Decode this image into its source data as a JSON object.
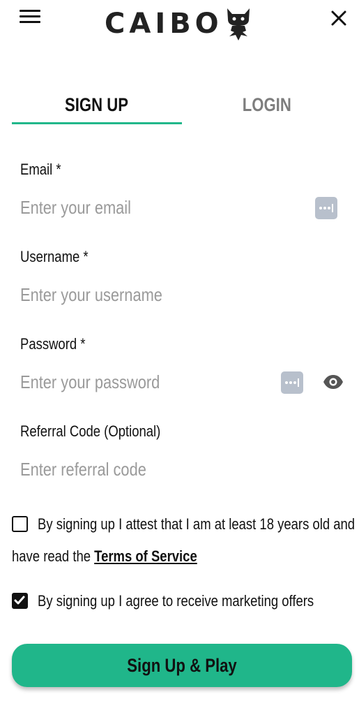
{
  "header": {
    "logo_text": "CAIBO",
    "menu_icon": "hamburger-menu-icon",
    "close_icon": "close-icon"
  },
  "tabs": [
    {
      "label": "SIGN UP",
      "active": true
    },
    {
      "label": "LOGIN",
      "active": false
    }
  ],
  "form": {
    "email": {
      "label": "Email *",
      "placeholder": "Enter your email",
      "value": ""
    },
    "username": {
      "label": "Username *",
      "placeholder": "Enter your username",
      "value": ""
    },
    "password": {
      "label": "Password *",
      "placeholder": "Enter your password",
      "value": ""
    },
    "referral": {
      "label": "Referral Code (Optional)",
      "placeholder": "Enter referral code",
      "value": ""
    }
  },
  "consent": {
    "age_text": "By signing up I attest that I am at least 18 years old and",
    "age_text_2": "have read the",
    "tos_link": "Terms of Service",
    "age_checked": false,
    "marketing_text": "By signing up I agree to receive marketing offers",
    "marketing_checked": true
  },
  "submit_label": "Sign Up & Play",
  "colors": {
    "accent": "#21b78a",
    "inactive_tab": "#7d7d7d",
    "placeholder": "#9a9a9a"
  }
}
